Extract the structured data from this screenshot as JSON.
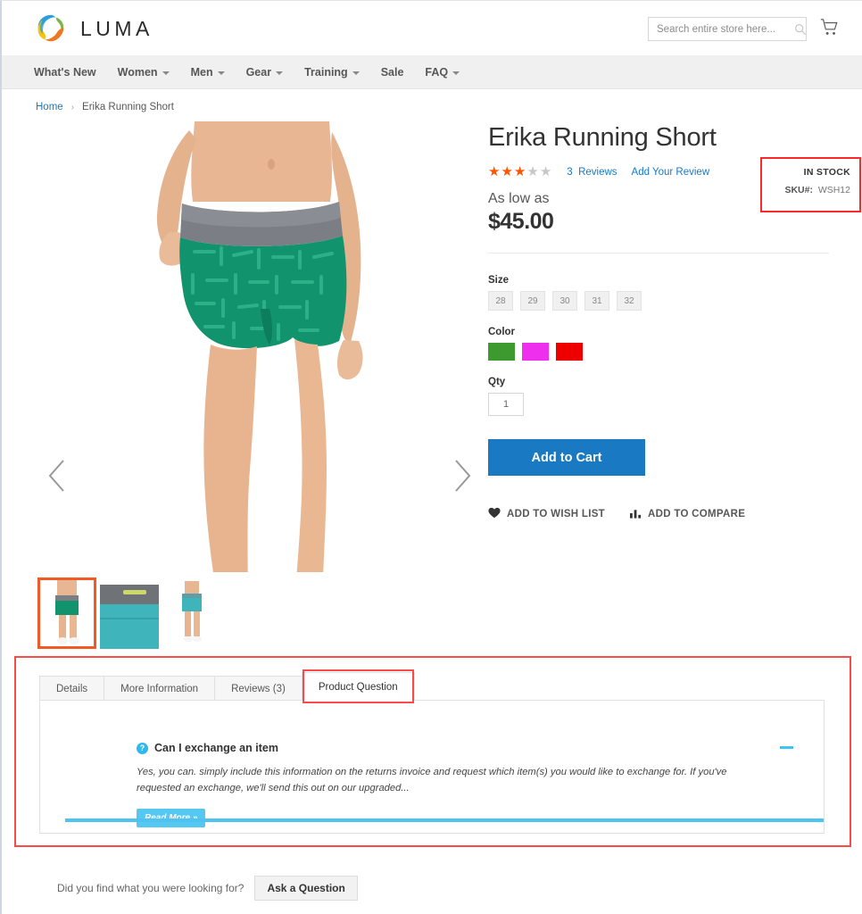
{
  "header": {
    "logo_text": "LUMA",
    "logo_icon": "luma-ring-logo",
    "search": {
      "placeholder": "Search entire store here...",
      "value": "",
      "icon": "search-icon"
    },
    "cart_icon": "shopping-cart-icon"
  },
  "nav": {
    "items": [
      {
        "label": "What's New",
        "has_caret": false
      },
      {
        "label": "Women",
        "has_caret": true
      },
      {
        "label": "Men",
        "has_caret": true
      },
      {
        "label": "Gear",
        "has_caret": true
      },
      {
        "label": "Training",
        "has_caret": true
      },
      {
        "label": "Sale",
        "has_caret": false
      },
      {
        "label": "FAQ",
        "has_caret": true
      }
    ]
  },
  "breadcrumb": {
    "home": "Home",
    "separator": "›",
    "current": "Erika Running Short"
  },
  "gallery": {
    "prev_label": "‹",
    "next_label": "›",
    "thumbs": [
      {
        "name": "thumb-front-view",
        "active": true
      },
      {
        "name": "thumb-waistband-detail",
        "active": false
      },
      {
        "name": "thumb-back-view",
        "active": false
      }
    ]
  },
  "product": {
    "title": "Erika Running Short",
    "rating": {
      "filled": 3,
      "total": 5,
      "color": "#ff5501"
    },
    "reviews_count": "3",
    "reviews_label": "Reviews",
    "add_review_label": "Add Your Review",
    "as_low_as": "As low as",
    "price": "$45.00",
    "stock_status": "IN STOCK",
    "sku_label": "SKU#:",
    "sku_value": "WSH12",
    "size": {
      "label": "Size",
      "options": [
        "28",
        "29",
        "30",
        "31",
        "32"
      ],
      "selected": ""
    },
    "color": {
      "label": "Color",
      "options": [
        {
          "name": "green",
          "hex": "#3c9a2e"
        },
        {
          "name": "magenta",
          "hex": "#ee30ee"
        },
        {
          "name": "red",
          "hex": "#ef0000"
        }
      ],
      "selected": ""
    },
    "qty": {
      "label": "Qty",
      "value": "1"
    },
    "add_to_cart_label": "Add to Cart",
    "wishlist_label": "ADD TO WISH LIST",
    "compare_label": "ADD TO COMPARE",
    "wishlist_icon": "heart-icon",
    "compare_icon": "bar-chart-icon"
  },
  "tabs": {
    "items": [
      {
        "label": "Details",
        "active": false
      },
      {
        "label": "More Information",
        "active": false
      },
      {
        "label": "Reviews (3)",
        "active": false
      },
      {
        "label": "Product Question",
        "active": true
      }
    ],
    "highlight_color": "#fb4a4a"
  },
  "faq": {
    "question_icon": "question-mark-icon",
    "question": "Can I exchange an item",
    "collapse_icon": "minus-icon",
    "answer": "Yes, you can. simply include this information on the returns invoice and request which item(s) you would like to exchange for. If you've requested an exchange, we'll send this out on our upgraded...",
    "read_more_label": "Read More »"
  },
  "footer": {
    "ask_text": "Did you find what you were looking for?",
    "ask_button_label": "Ask a Question"
  }
}
